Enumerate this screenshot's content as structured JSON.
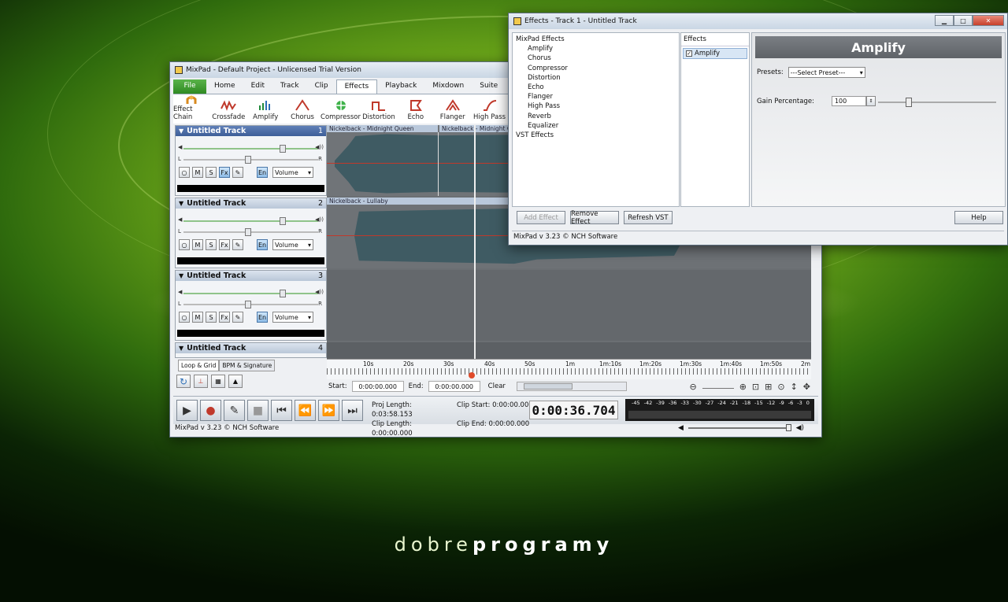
{
  "main": {
    "title": "MixPad - Default Project - Unlicensed Trial Version",
    "menu": [
      "File",
      "Home",
      "Edit",
      "Track",
      "Clip",
      "Effects",
      "Playback",
      "Mixdown",
      "Suite"
    ],
    "toolbar": [
      {
        "label": "Effect Chain",
        "icon": "effect-chain-icon"
      },
      {
        "label": "Crossfade",
        "icon": "crossfade-icon"
      },
      {
        "label": "Amplify",
        "icon": "amplify-icon"
      },
      {
        "label": "Chorus",
        "icon": "chorus-icon"
      },
      {
        "label": "Compressor",
        "icon": "compressor-icon"
      },
      {
        "label": "Distortion",
        "icon": "distortion-icon"
      },
      {
        "label": "Echo",
        "icon": "echo-icon"
      },
      {
        "label": "Flanger",
        "icon": "flanger-icon"
      },
      {
        "label": "High Pass",
        "icon": "high-pass-icon"
      }
    ],
    "tracks": [
      {
        "name": "Untitled Track",
        "num": "1"
      },
      {
        "name": "Untitled Track",
        "num": "2"
      },
      {
        "name": "Untitled Track",
        "num": "3"
      },
      {
        "name": "Untitled Track",
        "num": "4"
      }
    ],
    "track_buttons": {
      "mute": "M",
      "solo": "S",
      "fx": "Fx",
      "en": "En",
      "volume": "Volume",
      "left": "L",
      "right": "R"
    },
    "clips": [
      "Nickelback - Midnight Queen",
      "Nickelback - Midnight Q",
      "Nickelback - Lullaby"
    ],
    "ruler": [
      "10s",
      "20s",
      "30s",
      "40s",
      "50s",
      "1m",
      "1m:10s",
      "1m:20s",
      "1m:30s",
      "1m:40s",
      "1m:50s",
      "2m"
    ],
    "tabs": [
      "Loop & Grid",
      "BPM & Signature"
    ],
    "start_label": "Start:",
    "start_value": "0:00:00.000",
    "end_label": "End:",
    "end_value": "0:00:00.000",
    "clear": "Clear",
    "info": {
      "proj_length": "Proj Length: 0:03:58.153",
      "clip_start": "Clip Start: 0:00:00.000",
      "clip_length": "Clip Length: 0:00:00.000",
      "clip_end": "Clip End: 0:00:00.000"
    },
    "time": "0:00:36.704",
    "vu_scale": [
      "-45",
      "-42",
      "-39",
      "-36",
      "-33",
      "-30",
      "-27",
      "-24",
      "-21",
      "-18",
      "-15",
      "-12",
      "-9",
      "-6",
      "-3",
      "0"
    ],
    "status": "MixPad v 3.23 © NCH Software"
  },
  "fx": {
    "title": "Effects - Track 1 - Untitled Track",
    "tree_root": "MixPad Effects",
    "tree_items": [
      "Amplify",
      "Chorus",
      "Compressor",
      "Distortion",
      "Echo",
      "Flanger",
      "High Pass",
      "Reverb",
      "Equalizer"
    ],
    "tree_vst": "VST Effects",
    "list_header": "Effects",
    "list_item": "Amplify",
    "panel_title": "Amplify",
    "presets_label": "Presets:",
    "presets_value": "---Select Preset---",
    "gain_label": "Gain Percentage:",
    "gain_value": "100",
    "add": "Add Effect",
    "remove": "Remove Effect",
    "refresh": "Refresh VST",
    "help": "Help",
    "status": "MixPad v 3.23 © NCH Software"
  },
  "brand": {
    "a": "dobre",
    "b": "programy"
  }
}
